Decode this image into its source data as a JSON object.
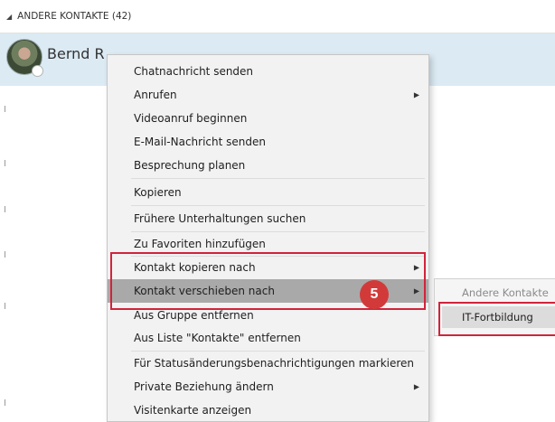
{
  "group": {
    "collapse_glyph": "◢",
    "title": "ANDERE KONTAKTE (42)"
  },
  "contact": {
    "name": "Bernd R"
  },
  "context_menu": {
    "items": [
      {
        "label": "Chatnachricht senden",
        "submenu": false
      },
      {
        "label": "Anrufen",
        "submenu": true
      },
      {
        "label": "Videoanruf beginnen",
        "submenu": false
      },
      {
        "label": "E-Mail-Nachricht senden",
        "submenu": false
      },
      {
        "label": "Besprechung planen",
        "submenu": false
      },
      {
        "label": "Kopieren",
        "submenu": false
      },
      {
        "label": "Frühere Unterhaltungen suchen",
        "submenu": false
      },
      {
        "label": "Zu Favoriten hinzufügen",
        "submenu": false
      },
      {
        "label": "Kontakt kopieren nach",
        "submenu": true
      },
      {
        "label": "Kontakt verschieben nach",
        "submenu": true,
        "highlighted": true
      },
      {
        "label": "Aus Gruppe entfernen",
        "submenu": false
      },
      {
        "label": "Aus Liste \"Kontakte\" entfernen",
        "submenu": false
      },
      {
        "label": "Für Statusänderungsbenachrichtigungen markieren",
        "submenu": false
      },
      {
        "label": "Private Beziehung ändern",
        "submenu": true
      },
      {
        "label": "Visitenkarte anzeigen",
        "submenu": false
      }
    ],
    "submenu_arrow": "▶"
  },
  "submenu": {
    "heading": "Andere Kontakte",
    "items": [
      "IT-Fortbildung"
    ]
  },
  "callout": {
    "number": "5",
    "color": "#d23a3a",
    "highlight_color": "#d0243b"
  },
  "colors": {
    "contact_row_bg": "#dceaf4",
    "menu_bg": "#f2f2f2",
    "menu_hover": "#a9a9a9"
  }
}
